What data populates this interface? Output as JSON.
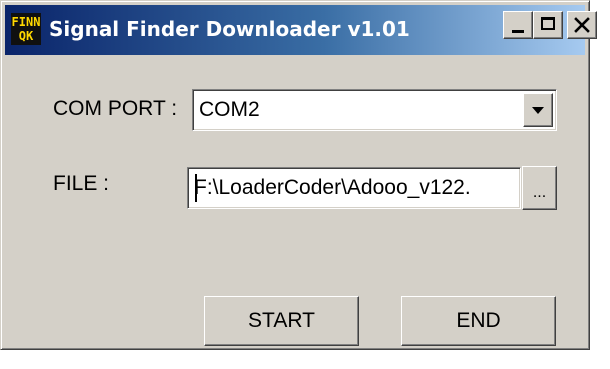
{
  "window": {
    "title": "Signal Finder Downloader v1.01",
    "icon_text_top": "FINN",
    "icon_text_bottom": "QK",
    "colors": {
      "title_start": "#0a246a",
      "title_end": "#a6caf0",
      "face": "#d4d0c8",
      "icon_text": "#ffd800"
    }
  },
  "controls": {
    "minimize_icon": "minimize-icon",
    "maximize_icon": "maximize-icon",
    "close_icon": "close-icon"
  },
  "form": {
    "com_port_label": "COM PORT :",
    "com_port_value": "COM2",
    "file_label": "FILE :",
    "file_value": "F:\\LoaderCoder\\Adooo_v122.",
    "browse_label": "..."
  },
  "buttons": {
    "start_label": "START",
    "end_label": "END"
  }
}
